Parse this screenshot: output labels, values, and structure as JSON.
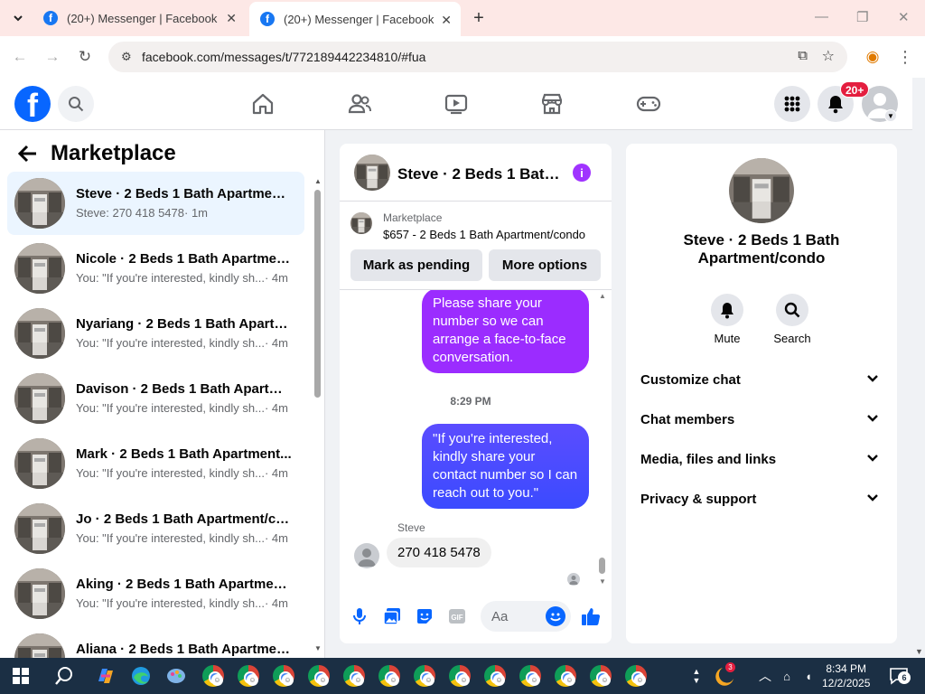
{
  "browser": {
    "tabs": [
      {
        "title": "(20+) Messenger | Facebook",
        "active": false
      },
      {
        "title": "(20+) Messenger | Facebook",
        "active": true
      }
    ],
    "url": "facebook.com/messages/t/772189442234810/#fua"
  },
  "fb_header": {
    "logo": "f",
    "notification_badge": "20+"
  },
  "left_panel": {
    "title": "Marketplace",
    "conversations": [
      {
        "name": "Steve · 2 Beds 1 Bath Apartment...",
        "preview": "Steve: 270 418 5478",
        "time": "· 1m",
        "active": true
      },
      {
        "name": "Nicole · 2 Beds 1 Bath Apartmen...",
        "preview": "You: \"If you're interested, kindly sh...",
        "time": "· 4m"
      },
      {
        "name": "Nyariang · 2 Beds 1 Bath Apartm...",
        "preview": "You: \"If you're interested, kindly sh...",
        "time": "· 4m"
      },
      {
        "name": "Davison · 2 Beds 1 Bath Apartme...",
        "preview": "You: \"If you're interested, kindly sh...",
        "time": "· 4m"
      },
      {
        "name": "Mark · 2 Beds 1 Bath Apartment...",
        "preview": "You: \"If you're interested, kindly sh...",
        "time": "· 4m"
      },
      {
        "name": "Jo · 2 Beds 1 Bath Apartment/co...",
        "preview": "You: \"If you're interested, kindly sh...",
        "time": "· 4m"
      },
      {
        "name": "Aking · 2 Beds 1 Bath Apartment...",
        "preview": "You: \"If you're interested, kindly sh...",
        "time": "· 4m"
      },
      {
        "name": "Aliana · 2 Beds 1 Bath Apartmen...",
        "preview": "",
        "time": ""
      }
    ]
  },
  "chat": {
    "title": "Steve · 2 Beds 1 Bath ...",
    "info_icon": "i",
    "marketplace_label": "Marketplace",
    "listing": "$657 - 2 Beds 1 Bath Apartment/condo",
    "mark_pending": "Mark as pending",
    "more_options": "More options",
    "messages": [
      {
        "from": "me",
        "text": "Please share your number so we can arrange a face-to-face conversation."
      },
      {
        "type": "timestamp",
        "text": "8:29 PM"
      },
      {
        "from": "me",
        "text": "\"If you're interested, kindly share your contact number so I can reach out to you.\""
      },
      {
        "from": "Steve",
        "sender_label": "Steve",
        "text": "270 418 5478"
      }
    ],
    "composer_placeholder": "Aa"
  },
  "info_panel": {
    "title": "Steve · 2 Beds 1 Bath Apartment/condo",
    "actions": [
      {
        "label": "Mute",
        "icon": "bell-icon"
      },
      {
        "label": "Search",
        "icon": "search-icon"
      }
    ],
    "sections": [
      "Customize chat",
      "Chat members",
      "Media, files and links",
      "Privacy & support"
    ]
  },
  "taskbar": {
    "time": "8:34 PM",
    "date": "12/2/2025",
    "weather_badge": "3",
    "notification_count": "6"
  },
  "colors": {
    "fb_blue": "#0866ff",
    "bubble_purple": "#9b2cff",
    "bubble_blue": "#4a4bff",
    "badge_red": "#e41e3f",
    "info_purple": "#a033ff",
    "active_row": "#ebf5ff"
  }
}
